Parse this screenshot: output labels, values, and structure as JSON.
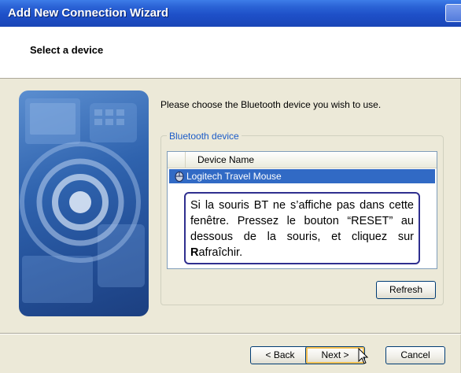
{
  "window": {
    "title": "Add New Connection Wizard"
  },
  "header": {
    "title": "Select a device"
  },
  "body": {
    "instruction": "Please choose the Bluetooth device you wish to use."
  },
  "group": {
    "legend": "Bluetooth device",
    "column_header": "Device Name",
    "devices": [
      {
        "name": "Logitech Travel Mouse",
        "icon": "bluetooth-mouse-icon",
        "selected": true
      }
    ]
  },
  "callout": {
    "part1": "Si la souris BT ne s’affiche pas dans cette fenêtre. Pressez le bouton “RESET” au dessous de la souris, et cliquez sur ",
    "bold": "R",
    "part2": "afraîchir."
  },
  "buttons": {
    "refresh": "Refresh",
    "back": "< Back",
    "next": "Next >",
    "cancel": "Cancel"
  },
  "colors": {
    "titlebar": "#1e50c8",
    "selection": "#316ac5",
    "callout_border": "#2f2f8f",
    "legend": "#1c5cc8"
  }
}
